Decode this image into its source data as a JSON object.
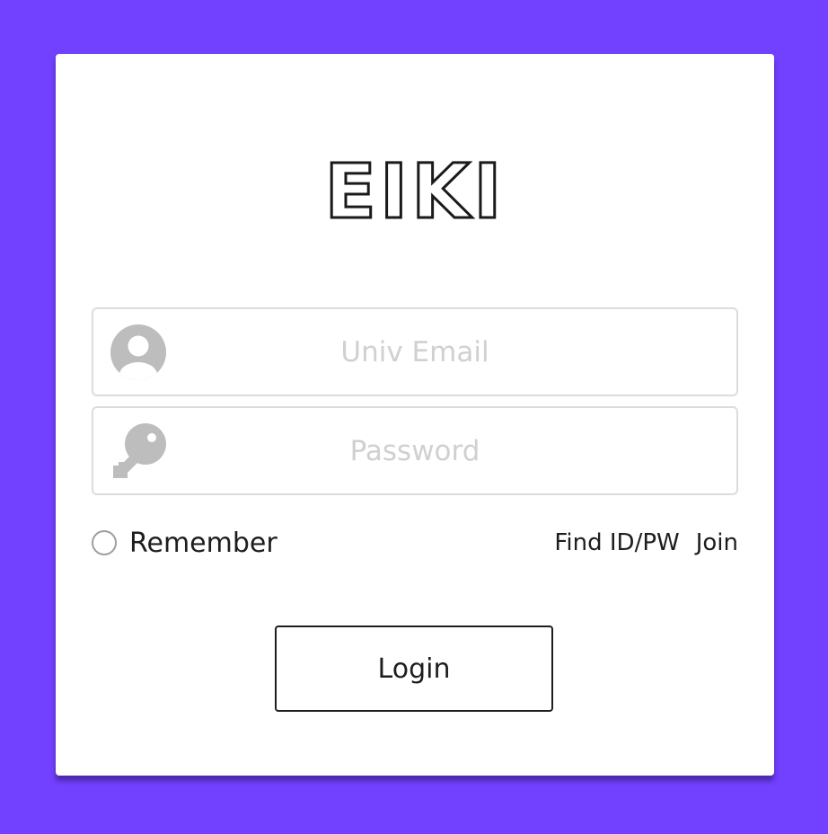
{
  "brand": {
    "logo_text": "EIKI"
  },
  "form": {
    "email": {
      "icon": "user-icon",
      "placeholder": "Univ Email",
      "value": ""
    },
    "password": {
      "icon": "key-icon",
      "placeholder": "Password",
      "value": ""
    },
    "remember_label": "Remember",
    "remember_checked": false,
    "find_link": "Find ID/PW",
    "join_link": "Join",
    "login_label": "Login"
  },
  "colors": {
    "background": "#7240FF",
    "card": "#FFFFFF",
    "icon": "#BDBDBD",
    "text": "#1E1E1E",
    "placeholder": "#D0D0D0"
  }
}
